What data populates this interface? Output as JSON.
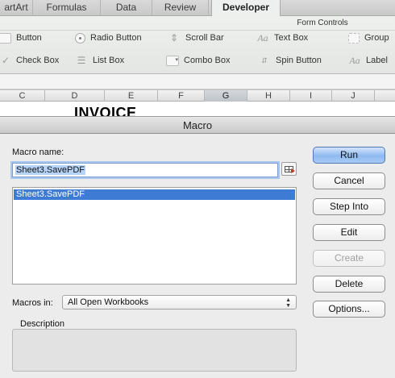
{
  "ribbon": {
    "tabs": [
      "artArt",
      "Formulas",
      "Data",
      "Review",
      "Developer"
    ],
    "active_tab": "Developer",
    "group_title": "Form Controls",
    "controls": {
      "button": "Button",
      "radio": "Radio Button",
      "scroll": "Scroll Bar",
      "textbox": "Text Box",
      "group": "Group",
      "checkbox": "Check Box",
      "listbox": "List Box",
      "combo": "Combo Box",
      "spin": "Spin Button",
      "label": "Label"
    }
  },
  "sheet": {
    "columns": [
      "C",
      "D",
      "E",
      "F",
      "G",
      "H",
      "I",
      "J"
    ],
    "selected_column": "G",
    "cell_text": "INVOICE"
  },
  "dialog": {
    "title": "Macro",
    "macro_name_label": "Macro name:",
    "macro_name_value": "Sheet3.SavePDF",
    "macros": [
      "Sheet3.SavePDF"
    ],
    "macros_in_label": "Macros in:",
    "macros_in_value": "All Open Workbooks",
    "description_label": "Description",
    "buttons": {
      "run": "Run",
      "cancel": "Cancel",
      "step_into": "Step Into",
      "edit": "Edit",
      "create": "Create",
      "delete": "Delete",
      "options": "Options..."
    }
  },
  "colors": {
    "selection": "#3d7bd4",
    "default_button": "#8fb9ef"
  }
}
